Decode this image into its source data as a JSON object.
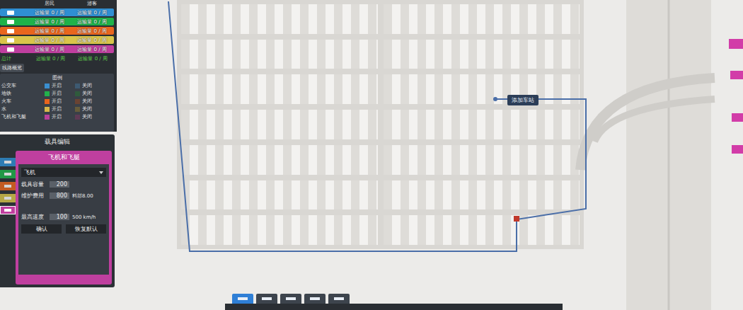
{
  "overview": {
    "columns": [
      "居民",
      "游客"
    ],
    "rows": [
      {
        "color": "#2f8fd3",
        "resident": "运输量 0 / 周",
        "tourist": "运输量 0 / 周"
      },
      {
        "color": "#1fb24a",
        "resident": "运输量 0 / 周",
        "tourist": "运输量 0 / 周"
      },
      {
        "color": "#e9661e",
        "resident": "运输量 0 / 周",
        "tourist": "运输量 0 / 周"
      },
      {
        "color": "#d9c54a",
        "resident": "运输量 0 / 周",
        "tourist": "运输量 0 / 周"
      },
      {
        "color": "#bf3f9f",
        "resident": "运输量 0 / 周",
        "tourist": "运输量 0 / 周"
      }
    ],
    "total": {
      "label": "总计",
      "resident": "运输量 0 / 周",
      "tourist": "运输量 0 / 周"
    }
  },
  "line_overview_button": "线路概览",
  "legend": {
    "title": "图例",
    "items": [
      {
        "label": "公交车",
        "on": "开启",
        "off": "关闭",
        "color": "#3a8fd0",
        "off_color": "#3d5a72"
      },
      {
        "label": "地铁",
        "on": "开启",
        "off": "关闭",
        "color": "#22b14c",
        "off_color": "#2f5b3c"
      },
      {
        "label": "火车",
        "on": "开启",
        "off": "关闭",
        "color": "#e8641c",
        "off_color": "#6a4332"
      },
      {
        "label": "水",
        "on": "开启",
        "off": "关闭",
        "color": "#d8b84a",
        "off_color": "#665c3a"
      },
      {
        "label": "飞机和飞艇",
        "on": "开启",
        "off": "关闭",
        "color": "#b8409a",
        "off_color": "#5e3a55"
      }
    ]
  },
  "editor": {
    "title": "载具编辑",
    "tabs": [
      {
        "color": "#2f8fd3",
        "selected": false
      },
      {
        "color": "#1fb24a",
        "selected": false
      },
      {
        "color": "#e9661e",
        "selected": false
      },
      {
        "color": "#d9c54a",
        "selected": false
      },
      {
        "color": "#bf3f9f",
        "selected": true
      }
    ],
    "category": "飞机和飞艇",
    "vehicle": "飞机",
    "fields": [
      {
        "label": "载具容量",
        "value": "200",
        "extra": ""
      },
      {
        "label": "维护费用",
        "value": "800",
        "extra": "料部8.00"
      },
      {
        "label": "最高速度",
        "value": "100",
        "extra": "500 km/h"
      }
    ],
    "buttons": [
      "确认",
      "恢复默认"
    ]
  },
  "map": {
    "tooltip": "添加车站"
  },
  "toolbar": {
    "tabs": [
      {
        "selected": true
      },
      {
        "selected": false
      },
      {
        "selected": false
      },
      {
        "selected": false
      },
      {
        "selected": false
      }
    ]
  }
}
